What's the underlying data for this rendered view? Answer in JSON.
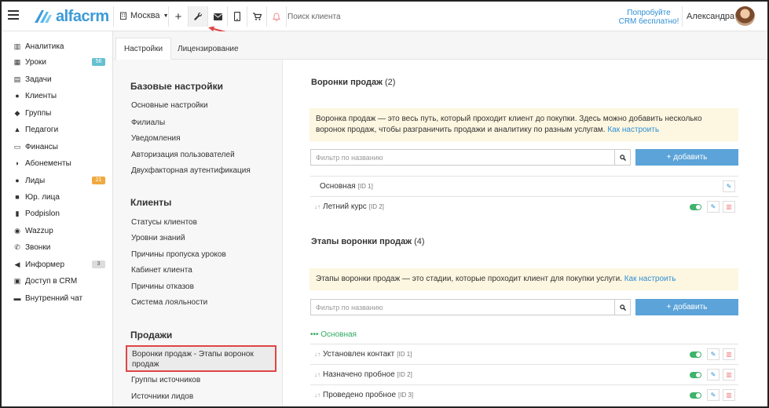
{
  "topbar": {
    "logo_text": "alfacrm",
    "branch": "Москва",
    "search_placeholder": "Поиск клиента",
    "promo_line1": "Попробуйте",
    "promo_line2": "CRM бесплатно!",
    "username": "Александра",
    "icons": [
      "menu-icon",
      "building-icon",
      "plus-icon",
      "wrench-icon",
      "envelope-icon",
      "phone-icon",
      "cart-icon",
      "bell-icon"
    ]
  },
  "sidebar": {
    "items": [
      {
        "label": "Аналитика",
        "icon": "chart-icon"
      },
      {
        "label": "Уроки",
        "icon": "calendar-icon",
        "badge": "56",
        "badge_color": "#67c0d1"
      },
      {
        "label": "Задачи",
        "icon": "clipboard-icon"
      },
      {
        "label": "Клиенты",
        "icon": "user-icon"
      },
      {
        "label": "Группы",
        "icon": "users-icon"
      },
      {
        "label": "Педагоги",
        "icon": "graduation-cap-icon"
      },
      {
        "label": "Финансы",
        "icon": "money-icon"
      },
      {
        "label": "Абонементы",
        "icon": "tag-icon"
      },
      {
        "label": "Лиды",
        "icon": "user-plus-icon",
        "badge": "21",
        "badge_color": "#f0a93e"
      },
      {
        "label": "Юр. лица",
        "icon": "briefcase-icon"
      },
      {
        "label": "Podpislon",
        "icon": "file-icon"
      },
      {
        "label": "Wazzup",
        "icon": "whatsapp-icon"
      },
      {
        "label": "Звонки",
        "icon": "phone-icon"
      },
      {
        "label": "Информер",
        "icon": "bullhorn-icon",
        "badge": "3",
        "badge_color": "#dcdcdc"
      },
      {
        "label": "Доступ в CRM",
        "icon": "lock-icon"
      },
      {
        "label": "Внутренний чат",
        "icon": "chat-icon"
      }
    ]
  },
  "tabs": [
    {
      "label": "Настройки",
      "active": true
    },
    {
      "label": "Лицензирование",
      "active": false
    }
  ],
  "settings_nav": {
    "groups": [
      {
        "title": "Базовые настройки",
        "links": [
          "Основные настройки",
          "Филиалы",
          "Уведомления",
          "Авторизация пользователей",
          "Двухфакторная аутентификация"
        ]
      },
      {
        "title": "Клиенты",
        "links": [
          "Статусы клиентов",
          "Уровни знаний",
          "Причины пропуска уроков",
          "Кабинет клиента",
          "Причины отказов",
          "Система лояльности"
        ]
      },
      {
        "title": "Продажи",
        "links": [
          "Воронки продаж - Этапы воронок продаж",
          "Группы источников",
          "Источники лидов"
        ]
      }
    ]
  },
  "funnels": {
    "title": "Воронки продаж",
    "count": "(2)",
    "info_text": "Воронка продаж — это весь путь, который проходит клиент до покупки. Здесь можно добавить несколько воронок продаж, чтобы разграничить продажи и аналитику по разным услугам.",
    "info_link": "Как настроить",
    "filter_placeholder": "Фильтр по названию",
    "add_label": "+ добавить",
    "rows": [
      {
        "name": "Основная",
        "id": "[ID 1]"
      },
      {
        "name": "Летний курс",
        "id": "[ID 2]"
      }
    ]
  },
  "stages": {
    "title": "Этапы воронки продаж",
    "count": "(4)",
    "info_text": "Этапы воронки продаж — это стадии, которые проходит клиент для покупки услуги.",
    "info_link": "Как настроить",
    "filter_placeholder": "Фильтр по названию",
    "add_label": "+ добавить",
    "group_label": "••• Основная",
    "rows": [
      {
        "name": "Установлен контакт",
        "id": "[ID 1]"
      },
      {
        "name": "Назначено пробное",
        "id": "[ID 2]"
      },
      {
        "name": "Проведено пробное",
        "id": "[ID 3]"
      }
    ]
  },
  "colors": {
    "accent": "#3c9ad6",
    "add_button": "#5ba3d8",
    "toggle_on": "#3eb36b",
    "info_bg": "#fdf6e0",
    "highlight_border": "#e04545",
    "arrow": "#e04545"
  }
}
